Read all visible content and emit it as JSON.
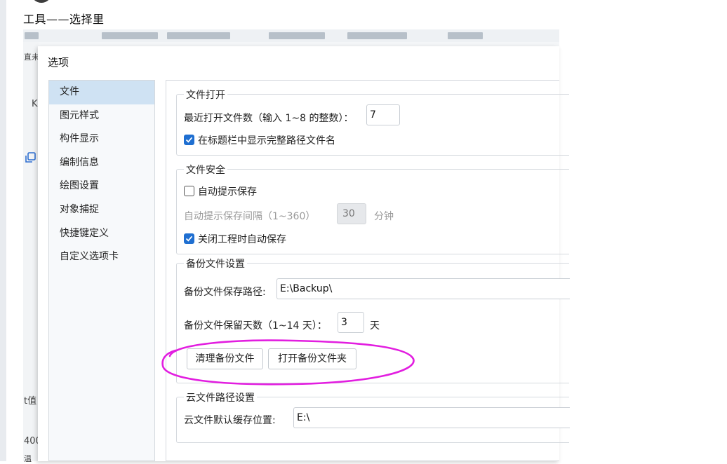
{
  "post": {
    "text": "工具——选择里"
  },
  "background": {
    "side_labels": [
      "直未",
      "K",
      "t值",
      "400",
      "温"
    ]
  },
  "dialog": {
    "title": "选项",
    "sidebar": {
      "items": [
        {
          "label": "文件",
          "selected": true
        },
        {
          "label": "图元样式",
          "selected": false
        },
        {
          "label": "构件显示",
          "selected": false
        },
        {
          "label": "编制信息",
          "selected": false
        },
        {
          "label": "绘图设置",
          "selected": false
        },
        {
          "label": "对象捕捉",
          "selected": false
        },
        {
          "label": "快捷键定义",
          "selected": false
        },
        {
          "label": "自定义选项卡",
          "selected": false
        }
      ]
    },
    "file_open": {
      "title": "文件打开",
      "recent_count_label": "最近打开文件数（输入 1~8 的整数）：",
      "recent_count_value": "7",
      "show_full_path_label": "在标题栏中显示完整路径文件名",
      "show_full_path_checked": true
    },
    "file_security": {
      "title": "文件安全",
      "auto_prompt_save_label": "自动提示保存",
      "auto_prompt_save_checked": false,
      "interval_label": "自动提示保存间隔（1~360）",
      "interval_value": "30",
      "interval_unit": "分钟",
      "auto_save_on_close_label": "关闭工程时自动保存",
      "auto_save_on_close_checked": true
    },
    "backup": {
      "title": "备份文件设置",
      "path_label": "备份文件保存路径:",
      "path_value": "E:\\Backup\\",
      "days_label": "备份文件保留天数（1~14 天）：",
      "days_value": "3",
      "days_unit": "天",
      "clean_button": "清理备份文件",
      "open_folder_button": "打开备份文件夹"
    },
    "cloud": {
      "title": "云文件路径设置",
      "cache_label": "云文件默认缓存位置:",
      "cache_value": "E:\\"
    }
  },
  "annotation": {
    "highlight_color": "#e21ee0"
  },
  "colors": {
    "accent": "#1f6fd1",
    "selected_bg": "#cfe2f3"
  }
}
